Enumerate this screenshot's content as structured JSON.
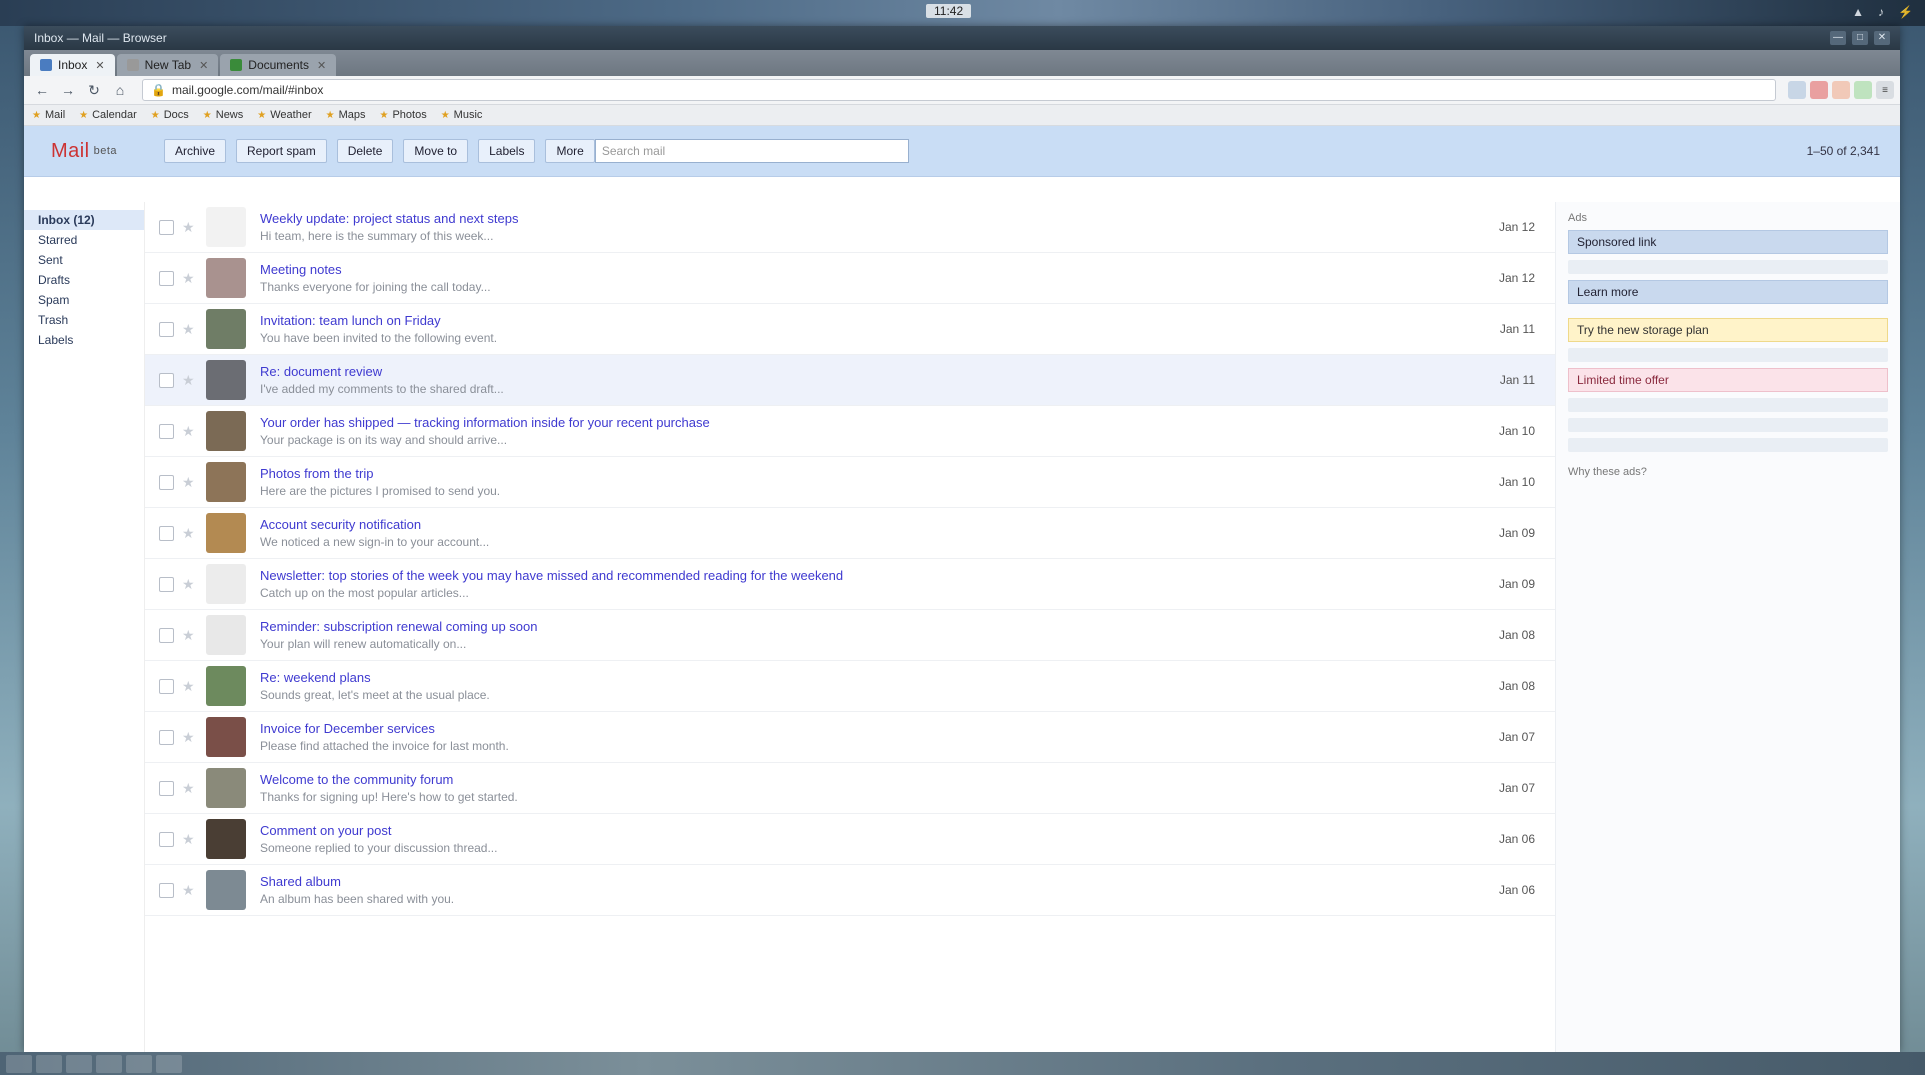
{
  "top_panel": {
    "clock": "11:42",
    "tray": [
      "▲",
      "♪",
      "⚡"
    ]
  },
  "window": {
    "title": "Inbox — Mail — Browser",
    "controls": [
      "—",
      "□",
      "✕"
    ]
  },
  "tabs": [
    {
      "label": "Inbox",
      "active": true
    },
    {
      "label": "New Tab",
      "active": false
    },
    {
      "label": "Documents",
      "active": false
    }
  ],
  "nav": {
    "back": "←",
    "forward": "→",
    "reload": "↻",
    "home": "⌂",
    "url": "mail.google.com/mail/#inbox"
  },
  "bookmarks": [
    "Mail",
    "Calendar",
    "Docs",
    "News",
    "Weather",
    "Maps",
    "Photos",
    "Music"
  ],
  "gmail": {
    "logo": "Mail",
    "logo_sub": "beta",
    "actions": [
      "Archive",
      "Report spam",
      "Delete",
      "Move to",
      "Labels",
      "More"
    ],
    "pager": "1–50 of 2,341",
    "search_placeholder": "Search mail"
  },
  "left_rail": [
    "Inbox (12)",
    "Starred",
    "Sent",
    "Drafts",
    "Spam",
    "Trash",
    "Labels"
  ],
  "emails": [
    {
      "subject": "Weekly update: project status and next steps",
      "snippet": "Hi team, here is the summary of this week...",
      "avatar": "#f2f2f2",
      "date": "Jan 12",
      "hl": false
    },
    {
      "subject": "Meeting notes",
      "snippet": "Thanks everyone for joining the call today...",
      "avatar": "#a9928f",
      "date": "Jan 12",
      "hl": false
    },
    {
      "subject": "Invitation: team lunch on Friday",
      "snippet": "You have been invited to the following event.",
      "avatar": "#6f7d66",
      "date": "Jan 11",
      "hl": false
    },
    {
      "subject": "Re: document review",
      "snippet": "I've added my comments to the shared draft...",
      "avatar": "#6b6d73",
      "date": "Jan 11",
      "hl": true
    },
    {
      "subject": "Your order has shipped — tracking information inside for your recent purchase",
      "snippet": "Your package is on its way and should arrive...",
      "avatar": "#7b6a55",
      "date": "Jan 10",
      "hl": false
    },
    {
      "subject": "Photos from the trip",
      "snippet": "Here are the pictures I promised to send you.",
      "avatar": "#8d7458",
      "date": "Jan 10",
      "hl": false
    },
    {
      "subject": "Account security notification",
      "snippet": "We noticed a new sign-in to your account...",
      "avatar": "#b38a52",
      "date": "Jan 09",
      "hl": false
    },
    {
      "subject": "Newsletter: top stories of the week you may have missed and recommended reading for the weekend",
      "snippet": "Catch up on the most popular articles...",
      "avatar": "#ececec",
      "date": "Jan 09",
      "hl": false
    },
    {
      "subject": "Reminder: subscription renewal coming up soon",
      "snippet": "Your plan will renew automatically on...",
      "avatar": "#e8e8e8",
      "date": "Jan 08",
      "hl": false
    },
    {
      "subject": "Re: weekend plans",
      "snippet": "Sounds great, let's meet at the usual place.",
      "avatar": "#6d8a5e",
      "date": "Jan 08",
      "hl": false
    },
    {
      "subject": "Invoice for December services",
      "snippet": "Please find attached the invoice for last month.",
      "avatar": "#7a4f48",
      "date": "Jan 07",
      "hl": false
    },
    {
      "subject": "Welcome to the community forum",
      "snippet": "Thanks for signing up! Here's how to get started.",
      "avatar": "#8a8a7a",
      "date": "Jan 07",
      "hl": false
    },
    {
      "subject": "Comment on your post",
      "snippet": "Someone replied to your discussion thread...",
      "avatar": "#4a3e34",
      "date": "Jan 06",
      "hl": false
    },
    {
      "subject": "Shared album",
      "snippet": "An album has been shared with you.",
      "avatar": "#7d8a93",
      "date": "Jan 06",
      "hl": false
    }
  ],
  "right_pane": {
    "title": "Ads",
    "box1": "Sponsored link",
    "box2": "Learn more",
    "note": "Try the new storage plan",
    "warn": "Limited time offer",
    "footer": "Why these ads?"
  },
  "colors": {
    "subject_link": "#3f3ad0",
    "header_blue": "#c9ddf5"
  }
}
